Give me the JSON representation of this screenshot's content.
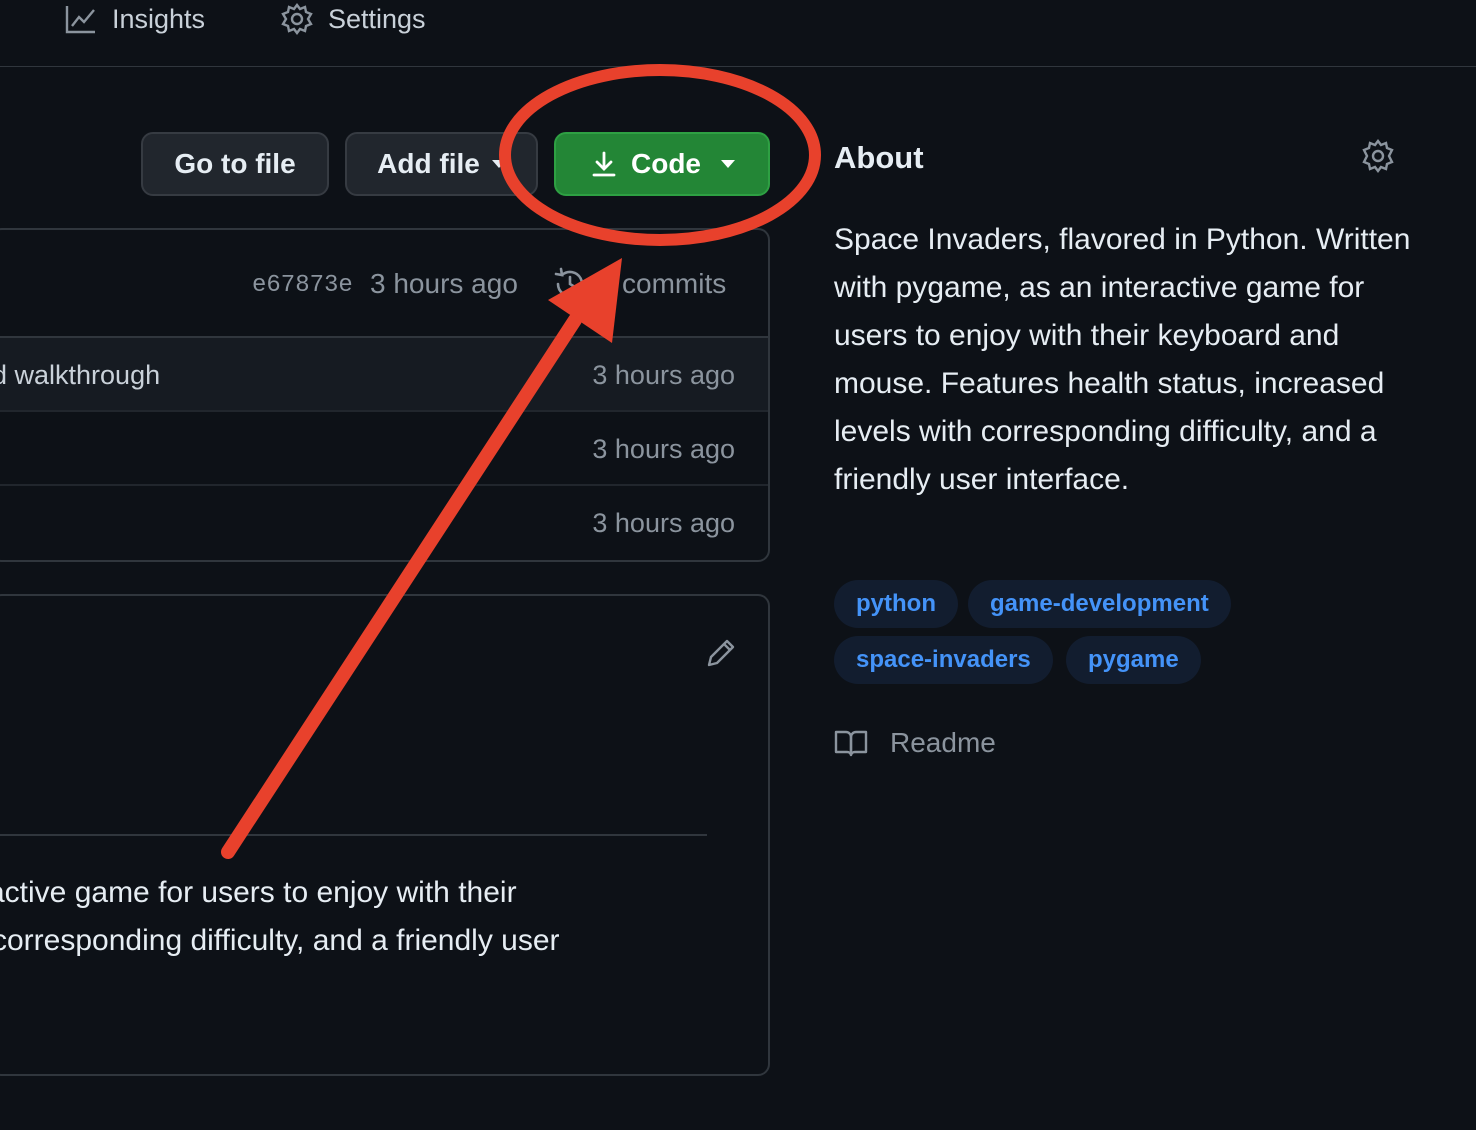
{
  "nav": {
    "insights_label": "Insights",
    "settings_label": "Settings"
  },
  "toolbar": {
    "go_to_file_label": "Go to file",
    "add_file_label": "Add file",
    "code_label": "Code"
  },
  "latest_commit": {
    "sha": "e67873e",
    "time": "3 hours ago",
    "commits_label": "commits"
  },
  "files": [
    {
      "message": "d walkthrough",
      "time": "3 hours ago"
    },
    {
      "message": "",
      "time": "3 hours ago"
    },
    {
      "message": "",
      "time": "3 hours ago"
    }
  ],
  "readme": {
    "line1": "ractive game for users to enjoy with their",
    "line2": "corresponding difficulty, and a friendly user"
  },
  "about": {
    "title": "About",
    "description": "Space Invaders, flavored in Python. Written with pygame, as an interactive game for users to enjoy with their keyboard and mouse. Features health status, increased levels with corresponding difficulty, and a friendly user interface.",
    "topics": [
      "python",
      "game-development",
      "space-invaders",
      "pygame"
    ],
    "readme_label": "Readme"
  },
  "colors": {
    "background": "#0d1117",
    "code_button": "#238636",
    "topic_text": "#4493f8",
    "annotation": "#e8412c"
  },
  "icons": [
    "graph-icon",
    "gear-icon",
    "download-icon",
    "history-icon",
    "pencil-icon",
    "book-icon"
  ]
}
